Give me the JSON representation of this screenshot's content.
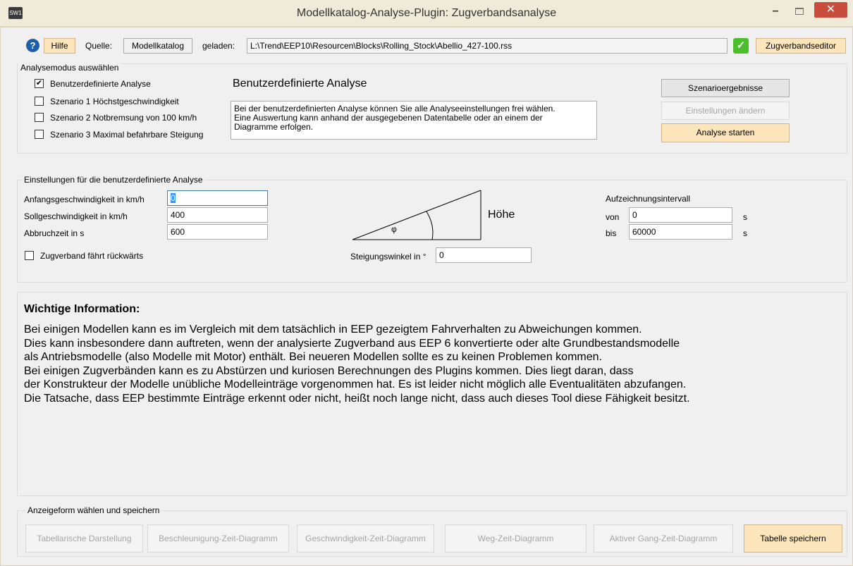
{
  "window": {
    "title": "Modellkatalog-Analyse-Plugin: Zugverbandsanalyse",
    "app_icon_label": "SW1"
  },
  "toolbar": {
    "help_label": "Hilfe",
    "source_label": "Quelle:",
    "source_value": "Modellkatalog",
    "loaded_label": "geladen:",
    "loaded_path": "L:\\Trend\\EEP10\\Resourcen\\Blocks\\Rolling_Stock\\Abellio_427-100.rss",
    "editor_label": "Zugverbandseditor"
  },
  "mode": {
    "group_label": "Analysemodus auswählen",
    "options": [
      {
        "label": "Benutzerdefinierte Analyse",
        "checked": true
      },
      {
        "label": "Szenario 1 Höchstgeschwindigkeit",
        "checked": false
      },
      {
        "label": "Szenario 2 Notbremsung von 100 km/h",
        "checked": false
      },
      {
        "label": "Szenario 3 Maximal befahrbare Steigung",
        "checked": false
      }
    ],
    "heading": "Benutzerdefinierte Analyse",
    "description": [
      "Bei der benutzerdefinierten Analyse können Sie alle Analyseeinstellungen frei wählen.",
      "Eine Auswertung kann anhand der ausgegebenen Datentabelle oder an einem der",
      "Diagramme erfolgen."
    ],
    "btn_results": "Szenarioergebnisse",
    "btn_change": "Einstellungen ändern",
    "btn_start": "Analyse starten"
  },
  "settings": {
    "group_label": "Einstellungen für die benutzerdefinierte Analyse",
    "start_speed_label": "Anfangsgeschwindigkeit in km/h",
    "start_speed_value": "0",
    "target_speed_label": "Sollgeschwindigkeit in km/h",
    "target_speed_value": "400",
    "abort_time_label": "Abbruchzeit in s",
    "abort_time_value": "600",
    "reverse_label": "Zugverband fährt rückwärts",
    "height_label": "Höhe",
    "phi_label": "φ",
    "slope_label": "Steigungswinkel in °",
    "slope_value": "0",
    "interval_label": "Aufzeichnungsintervall",
    "from_label": "von",
    "from_value": "0",
    "to_label": "bis",
    "to_value": "60000",
    "unit_s": "s"
  },
  "info": {
    "title": "Wichtige Information:",
    "lines": [
      "Bei einigen Modellen kann es im Vergleich mit dem tatsächlich in EEP gezeigtem Fahrverhalten zu Abweichungen kommen.",
      "Dies kann insbesondere dann auftreten, wenn der analysierte Zugverband aus EEP 6 konvertierte oder alte Grundbestandsmodelle",
      "als Antriebsmodelle (also Modelle mit Motor) enthält. Bei neueren Modellen sollte es zu keinen Problemen kommen.",
      "Bei einigen Zugverbänden kann es zu Abstürzen und kuriosen Berechnungen des Plugins kommen. Dies liegt daran, dass",
      "der Konstrukteur der Modelle unübliche Modelleinträge vorgenommen hat. Es ist leider nicht möglich alle Eventualitäten abzufangen.",
      "Die Tatsache, dass EEP bestimmte Einträge erkennt oder nicht, heißt noch lange nicht, dass auch dieses Tool diese Fähigkeit besitzt."
    ]
  },
  "display": {
    "group_label": "Anzeigeform wählen und speichern",
    "buttons": [
      "Tabellarische Darstellung",
      "Beschleunigung-Zeit-Diagramm",
      "Geschwindigkeit-Zeit-Diagramm",
      "Weg-Zeit-Diagramm",
      "Aktiver Gang-Zeit-Diagramm",
      "Tabelle speichern"
    ]
  },
  "icons": {
    "help": "help-icon",
    "loaded_ok": "checkmark-icon",
    "checkbox_checked": "✔",
    "close": "✕",
    "minimize": "–"
  },
  "colors": {
    "highlight_button": "#fde5bb",
    "help_icon": "#1d5fa8",
    "ok_icon": "#4bbf2b",
    "close_button": "#c94c3c"
  }
}
